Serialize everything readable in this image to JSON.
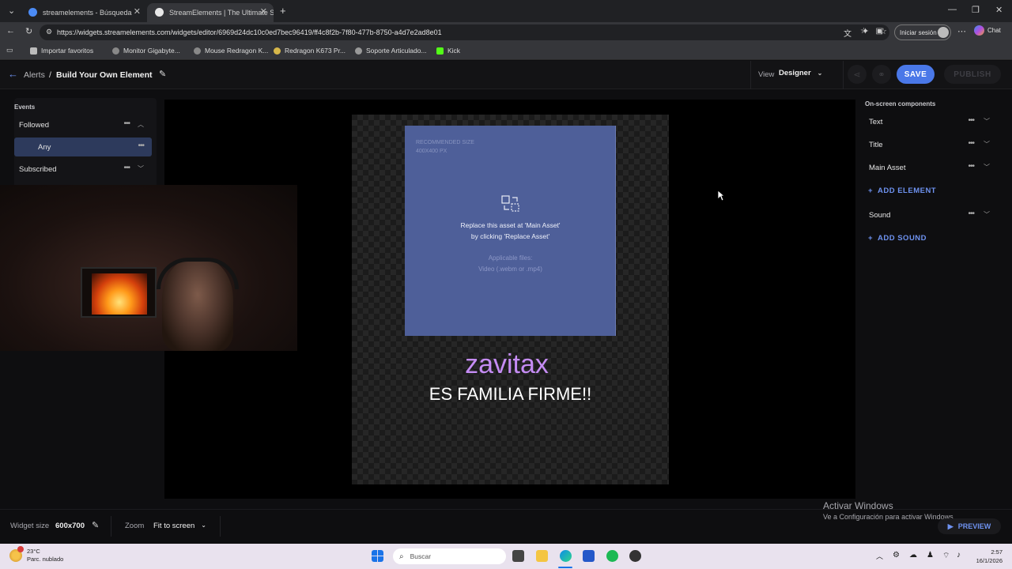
{
  "browser": {
    "tabs": [
      {
        "title": "streamelements - Búsqueda",
        "active": false
      },
      {
        "title": "StreamElements | The Ultimate St",
        "active": true
      }
    ],
    "url": "https://widgets.streamelements.com/widgets/editor/6969d24dc10c0ed7bec96419/ff4c8f2b-7f80-477b-8750-a4d7e2ad8e01",
    "signin_label": "Iniciar sesión",
    "chat_label": "Chat",
    "bookmarks": [
      "Importar favoritos",
      "Monitor Gigabyte...",
      "Mouse Redragon K...",
      "Redragon K673 Pr...",
      "Soporte Articulado...",
      "Kick"
    ]
  },
  "header": {
    "breadcrumb_root": "Alerts",
    "separator": "/",
    "title": "Build Your Own Element",
    "view_label": "View",
    "view_value": "Designer",
    "save_label": "SAVE",
    "publish_label": "PUBLISH"
  },
  "events": {
    "section_title": "Events",
    "items": [
      {
        "label": "Followed",
        "expanded": true
      },
      {
        "label": "Any",
        "selected": true
      },
      {
        "label": "Subscribed",
        "expanded": false
      }
    ]
  },
  "canvas": {
    "recommended_line1": "RECOMMENDED SIZE",
    "recommended_line2": "400X400 PX",
    "asset_msg_line1": "Replace this asset at 'Main Asset'",
    "asset_msg_line2": "by clicking 'Replace Asset'",
    "applicable_line1": "Applicable files:",
    "applicable_line2": "Video (.webm or .mp4)",
    "name_text": "zavitax",
    "message_text": "ES FAMILIA FIRME!!"
  },
  "components": {
    "section_title": "On-screen components",
    "items": [
      {
        "label": "Text"
      },
      {
        "label": "Title"
      },
      {
        "label": "Main Asset"
      }
    ],
    "add_element_label": "ADD ELEMENT",
    "sound_label": "Sound",
    "add_sound_label": "ADD SOUND"
  },
  "footer": {
    "widget_size_label": "Widget size",
    "widget_size_value": "600x700",
    "zoom_label": "Zoom",
    "zoom_value": "Fit to screen",
    "preview_label": "PREVIEW"
  },
  "watermark": {
    "line1": "Activar Windows",
    "line2": "Ve a Configuración para activar Windows."
  },
  "taskbar": {
    "temperature": "23°C",
    "weather": "Parc. nublado",
    "search_placeholder": "Buscar",
    "time": "2:57",
    "date": "16/1/2026"
  },
  "colors": {
    "accent": "#4a78e8",
    "name_text": "#c58cf4",
    "asset_bg": "#4e5f99"
  }
}
